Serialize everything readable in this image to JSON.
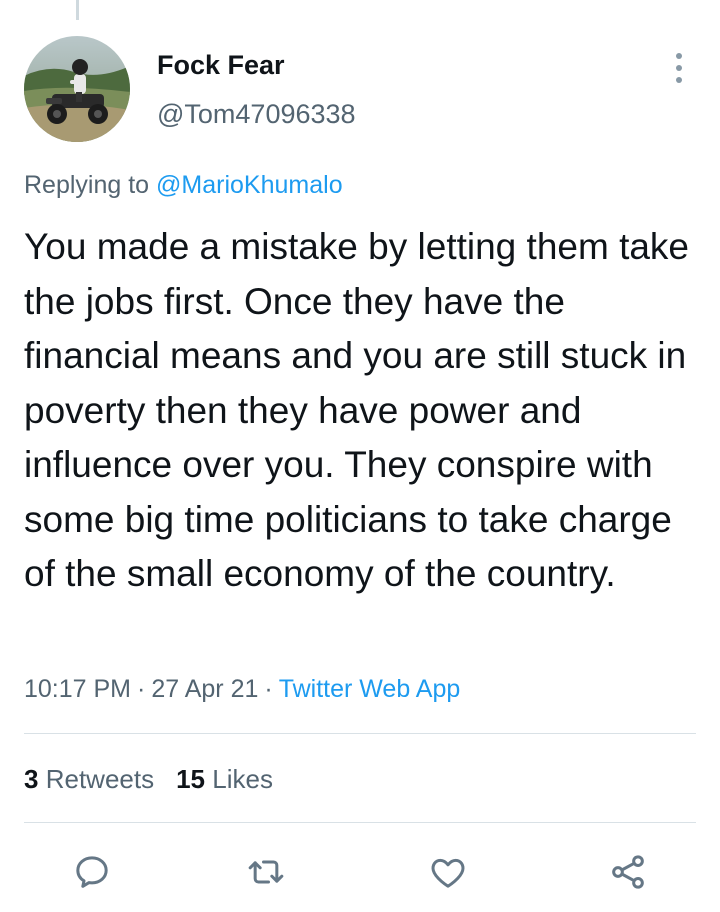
{
  "author": {
    "display_name": "Fock Fear",
    "handle": "@Tom47096338",
    "avatar_icon": "avatar-photo-atv-rider"
  },
  "reply_context": {
    "prefix": "Replying to",
    "mention": "@MarioKhumalo"
  },
  "tweet": {
    "text": "You made a mistake by letting them take the jobs first. Once they have the financial means and you are still stuck in poverty then they have power and influence over you. They conspire with some big time politicians to take charge of the small economy of the country."
  },
  "meta": {
    "time": "10:17 PM",
    "separator": "·",
    "date": "27 Apr 21",
    "source": "Twitter Web App"
  },
  "stats": {
    "retweets_count": "3",
    "retweets_label": "Retweets",
    "likes_count": "15",
    "likes_label": "Likes"
  },
  "actions": {
    "reply_icon": "reply-icon",
    "retweet_icon": "retweet-icon",
    "like_icon": "like-icon",
    "share_icon": "share-icon",
    "more_icon": "more-vertical-icon"
  },
  "colors": {
    "link_blue": "#1d9bf0",
    "secondary_text": "#536471",
    "primary_text": "#0f1419",
    "icon_gray": "#657786"
  }
}
